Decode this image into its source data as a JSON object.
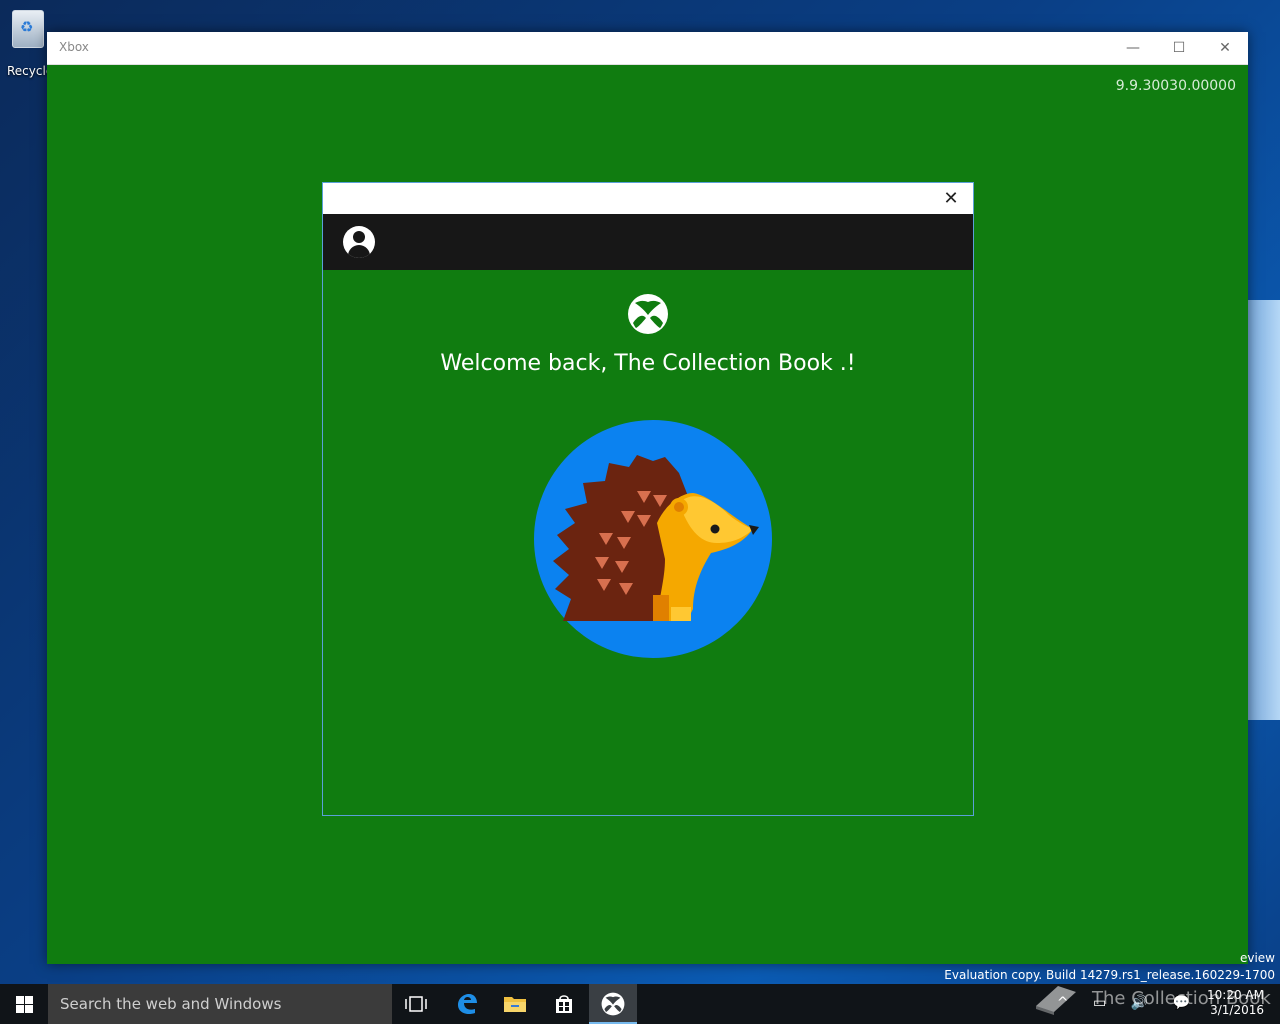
{
  "desktop": {
    "recycle_bin_label": "Recycle"
  },
  "window": {
    "title": "Xbox",
    "minimize": "—",
    "maximize": "☐",
    "close": "✕",
    "version": "9.9.30030.00000"
  },
  "dialog": {
    "close": "✕",
    "welcome_text": "Welcome back, The Collection Book .!"
  },
  "system": {
    "preview_tail": "eview",
    "evaluation_text": "Evaluation copy. Build 14279.rs1_release.160229-1700"
  },
  "taskbar": {
    "search_placeholder": "Search the web and Windows",
    "time": "10:20 AM",
    "date": "3/1/2016",
    "tray_symbols": "^ ▭ 🔊 💬"
  },
  "watermark": {
    "text": "The Collection Book"
  },
  "colors": {
    "xbox_green": "#107c10",
    "user_bar": "#171717",
    "gamerpic_bg": "#0b82f0"
  }
}
